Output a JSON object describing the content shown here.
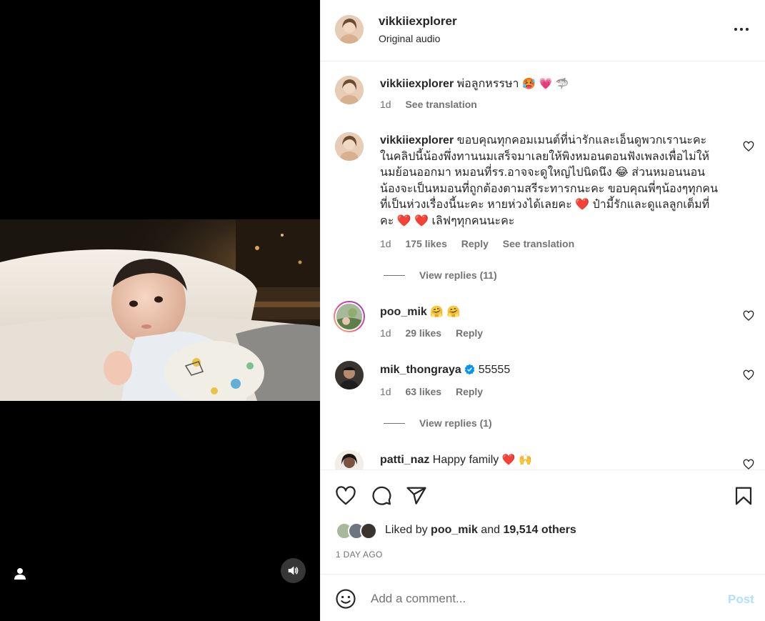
{
  "header": {
    "username": "vikkiiexplorer",
    "audio": "Original audio",
    "more_icon": "ellipsis-icon"
  },
  "caption": {
    "username": "vikkiiexplorer",
    "text": "พ่อลูกหรรษา",
    "emojis": "🥵 💗 🦈",
    "time": "1d",
    "translate": "See translation"
  },
  "comments": [
    {
      "username": "vikkiiexplorer",
      "text": "ขอบคุณทุกคอมเมนต์ที่น่ารักและเอ็นดูพวกเรานะคะ ในคลิปนี้น้องพึ่งทานนมเสร็จมาเลยให้พิงหมอนตอนฟังเพลงเพื่อไม่ให้นมย้อนออกมา หมอนที่รร.อาจจะดูใหญ่ไปนิดนึง 😂 ส่วนหมอนนอนน้องจะเป็นหมอนที่ถูกต้องตามสรีระทารกนะคะ ขอบคุณพี่ๆน้องๆทุกคนที่เป็นห่วงเรื่องนี้นะคะ หายห่วงได้เลยคะ ❤️ ป๋ามี้รักและดูแลลูกเต็มที่คะ ❤️ ❤️ เลิฟๆทุกคนนะคะ",
      "time": "1d",
      "likes": "175 likes",
      "reply": "Reply",
      "translate": "See translation",
      "view_replies": "View replies (11)"
    },
    {
      "username": "poo_mik",
      "text": "🤗 🤗",
      "time": "1d",
      "likes": "29 likes",
      "reply": "Reply"
    },
    {
      "username": "mik_thongraya",
      "text": "55555",
      "verified_icon": "verified-badge-icon",
      "time": "1d",
      "likes": "63 likes",
      "reply": "Reply",
      "view_replies": "View replies (1)"
    },
    {
      "username": "patti_naz",
      "text": "Happy family",
      "emojis": "❤️ 🙌"
    }
  ],
  "actions": {
    "like_icon": "heart-icon",
    "comment_icon": "comment-icon",
    "share_icon": "paper-plane-icon",
    "save_icon": "bookmark-icon"
  },
  "likes": {
    "prefix": "Liked by",
    "user": "poo_mik",
    "middle": "and",
    "others": "19,514 others"
  },
  "date": "1 DAY AGO",
  "add_comment": {
    "placeholder": "Add a comment...",
    "post": "Post"
  },
  "colors": {
    "accent_disabled": "#b2dffc",
    "verified": "#0095f6",
    "heart_red": "#e0245e",
    "secondary_text": "#737373"
  }
}
